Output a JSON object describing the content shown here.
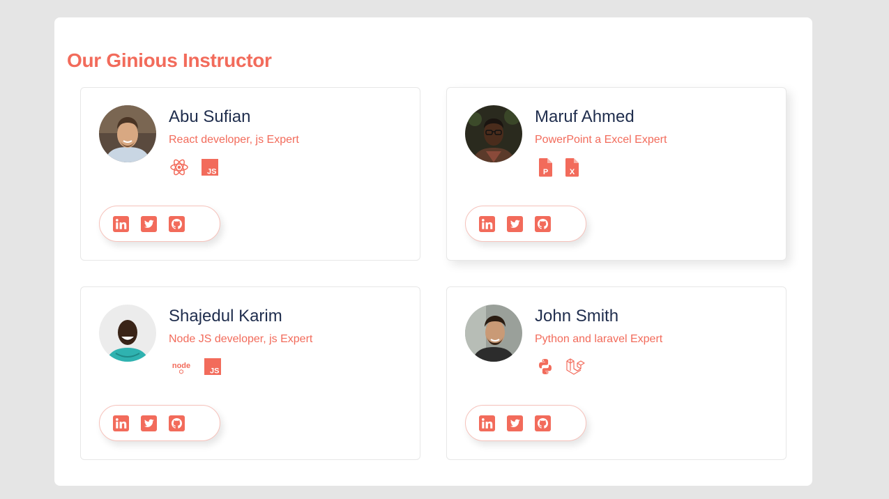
{
  "section": {
    "title": "Our Ginious Instructor"
  },
  "accent_color": "#f26b5b",
  "name_color": "#1f2d4d",
  "instructors": [
    {
      "name": "Abu Sufian",
      "role": "React developer, js Expert",
      "skills": [
        "react-icon",
        "javascript-icon"
      ],
      "social": [
        "linkedin-icon",
        "twitter-icon",
        "github-icon"
      ]
    },
    {
      "name": "Maruf Ahmed",
      "role": "PowerPoint a Excel Expert",
      "skills": [
        "powerpoint-file-icon",
        "excel-file-icon"
      ],
      "social": [
        "linkedin-icon",
        "twitter-icon",
        "github-icon"
      ]
    },
    {
      "name": "Shajedul Karim",
      "role": "Node JS developer, js Expert",
      "skills": [
        "nodejs-icon",
        "javascript-icon"
      ],
      "social": [
        "linkedin-icon",
        "twitter-icon",
        "github-icon"
      ]
    },
    {
      "name": "John Smith",
      "role": "Python and laravel Expert",
      "skills": [
        "python-icon",
        "laravel-icon"
      ],
      "social": [
        "linkedin-icon",
        "twitter-icon",
        "github-icon"
      ]
    }
  ]
}
